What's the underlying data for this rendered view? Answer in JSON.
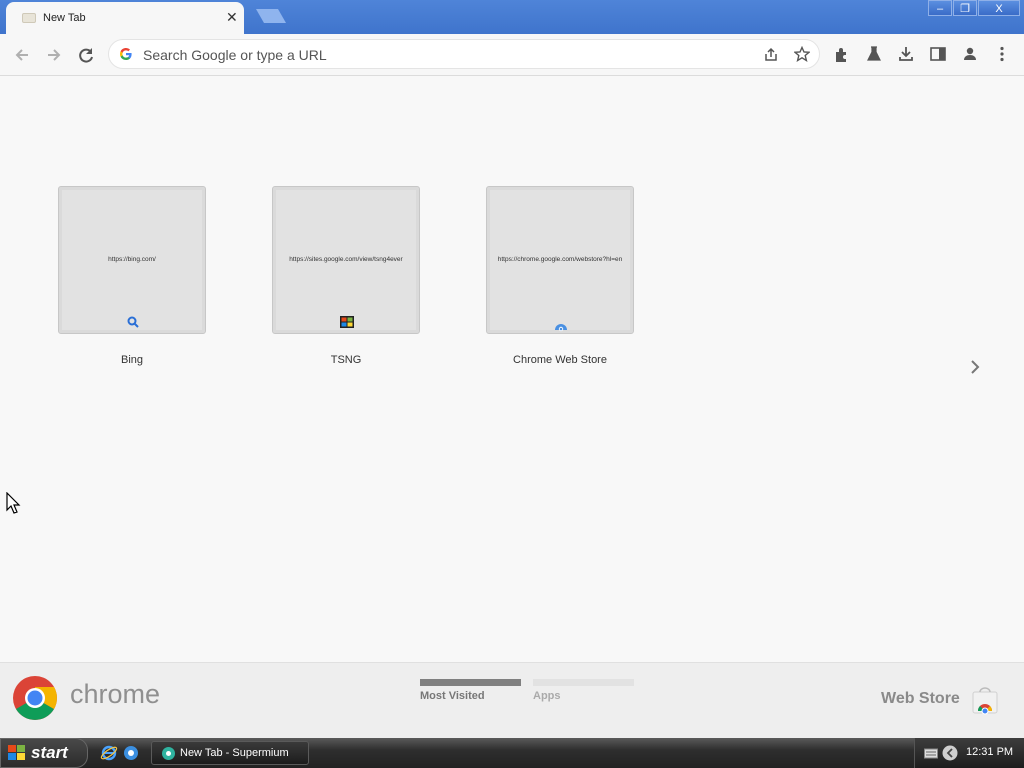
{
  "browser": {
    "tab_title": "New Tab",
    "tab_close": "✕",
    "address_placeholder": "Search Google or type a URL",
    "window_controls": {
      "minimize": "–",
      "restore": "❐",
      "close": "X"
    }
  },
  "most_visited": [
    {
      "label": "Bing",
      "url": "https://bing.com/",
      "icon": "search-icon"
    },
    {
      "label": "TSNG",
      "url": "https://sites.google.com/view/tsng4ever",
      "icon": "windows-flag-icon"
    },
    {
      "label": "Chrome Web Store",
      "url": "https://chrome.google.com/webstore?hl=en",
      "icon": "chrome-webstore-icon"
    }
  ],
  "footer": {
    "brand": "chrome",
    "tabs": [
      {
        "label": "Most Visited",
        "active": true
      },
      {
        "label": "Apps",
        "active": false
      }
    ],
    "webstore_label": "Web Store"
  },
  "taskbar": {
    "start_label": "start",
    "task_label": "New Tab - Supermium",
    "clock": "12:31 PM"
  },
  "colors": {
    "titlebar": "#4a7fd4",
    "footer_active_bar": "#808080",
    "footer_inactive_bar": "#e2e2e2"
  }
}
